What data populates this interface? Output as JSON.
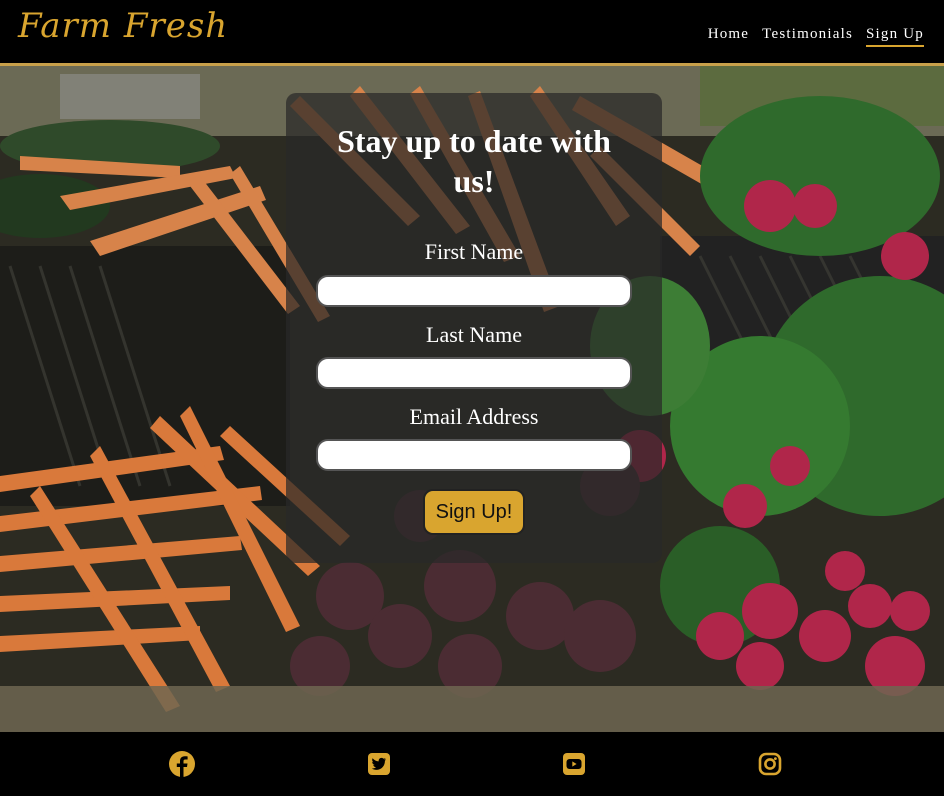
{
  "brand": {
    "logo_text": "Farm Fresh"
  },
  "nav": {
    "items": [
      {
        "label": "Home"
      },
      {
        "label": "Testimonials"
      },
      {
        "label": "Sign Up"
      }
    ]
  },
  "form": {
    "heading": "Stay up to date with us!",
    "fields": [
      {
        "label": "First Name",
        "value": "",
        "placeholder": ""
      },
      {
        "label": "Last Name",
        "value": "",
        "placeholder": ""
      },
      {
        "label": "Email Address",
        "value": "",
        "placeholder": ""
      }
    ],
    "submit_label": "Sign Up!"
  },
  "footer": {
    "icons": [
      "facebook-icon",
      "twitter-icon",
      "youtube-icon",
      "instagram-icon"
    ]
  },
  "colors": {
    "accent": "#d9a52f",
    "background": "#000000",
    "panel": "rgba(40,40,40,0.72)"
  }
}
